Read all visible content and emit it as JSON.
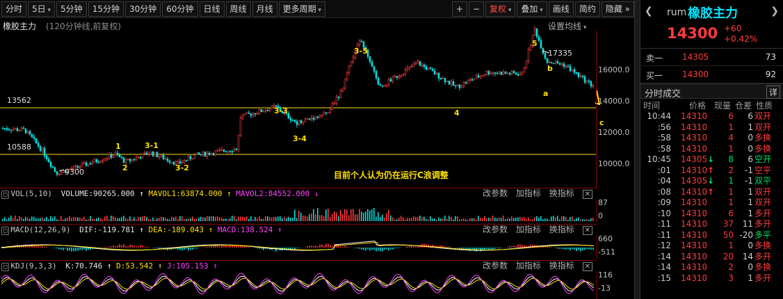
{
  "toolbar": {
    "items": [
      "分时",
      "5日",
      "5分钟",
      "15分钟",
      "30分钟",
      "60分钟",
      "日线",
      "周线",
      "月线",
      "更多周期"
    ],
    "right_items": [
      "+",
      "−",
      "复权",
      "叠加",
      "画线",
      "简约",
      "隐藏"
    ],
    "more_icon": "double-chevron-right-icon"
  },
  "main_chart": {
    "title": "橡胶主力",
    "subtitle": "(120分钟线,前复权)",
    "ma_setting": "设置均线",
    "y_ticks": [
      "16000.0",
      "14000.0",
      "12000.0",
      "10000.0"
    ],
    "ref_lines": [
      "13562",
      "10588"
    ],
    "high_label": "17335",
    "low_label": "9300",
    "waves": [
      "1",
      "2",
      "3-1",
      "3-2",
      "3-3",
      "3-4",
      "3-5",
      "4",
      "5",
      "a",
      "b",
      "c"
    ],
    "annotation": "目前个人认为仍在运行C浪调整"
  },
  "vol_panel": {
    "name": "VOL(5,10)",
    "volume": "VOLUME:90265.000",
    "mavol1": "MAVOL1:63874.000",
    "mavol2": "MAVOL2:84552.000",
    "y_ticks": [
      "87",
      "0"
    ]
  },
  "macd_panel": {
    "name": "MACD(12,26,9)",
    "dif": "DIF:-119.781",
    "dea": "DEA:-189.043",
    "macd": "MACD:138.524",
    "y_ticks": [
      "660",
      "-511"
    ]
  },
  "kdj_panel": {
    "name": "KDJ(9,3,3)",
    "k": "K:70.746",
    "d": "D:53.542",
    "j": "J:105.153",
    "y_ticks": [
      "116",
      "-13"
    ]
  },
  "panel_tools": {
    "params": "改参数",
    "add": "加指标",
    "swap": "换指标"
  },
  "quote": {
    "code": "rum",
    "name": "橡胶主力",
    "price": "14300",
    "change": "+60",
    "change_pct": "+0.42%",
    "sell1_label": "卖一",
    "sell1_price": "14305",
    "sell1_vol": "73",
    "buy1_label": "买一",
    "buy1_price": "14300",
    "buy1_vol": "92"
  },
  "ticks": {
    "title": "分时成交",
    "detail": "详",
    "headers": [
      "时间",
      "价格",
      "现量",
      "仓差",
      "性质"
    ],
    "rows": [
      {
        "time": "10:44",
        "price": "14310",
        "arrow": "",
        "vol": "6",
        "oi": "6",
        "nature": "双开"
      },
      {
        "time": ":56",
        "price": "14310",
        "arrow": "",
        "vol": "1",
        "oi": "1",
        "nature": "双开"
      },
      {
        "time": ":58",
        "price": "14310",
        "arrow": "",
        "vol": "4",
        "oi": "0",
        "nature": "多换"
      },
      {
        "time": ":58",
        "price": "14310",
        "arrow": "",
        "vol": "1",
        "oi": "0",
        "nature": "多换"
      },
      {
        "time": "10:45",
        "price": "14305",
        "arrow": "down",
        "vol": "8",
        "oi": "6",
        "nature": "空开"
      },
      {
        "time": ":01",
        "price": "14310",
        "arrow": "up",
        "vol": "2",
        "oi": "-1",
        "nature": "空平"
      },
      {
        "time": ":04",
        "price": "14305",
        "arrow": "down",
        "vol": "1",
        "oi": "-1",
        "nature": "双平"
      },
      {
        "time": ":08",
        "price": "14310",
        "arrow": "up",
        "vol": "1",
        "oi": "1",
        "nature": "双开"
      },
      {
        "time": ":09",
        "price": "14310",
        "arrow": "",
        "vol": "1",
        "oi": "1",
        "nature": "双开"
      },
      {
        "time": ":10",
        "price": "14310",
        "arrow": "",
        "vol": "6",
        "oi": "1",
        "nature": "多开"
      },
      {
        "time": ":11",
        "price": "14310",
        "arrow": "",
        "vol": "37",
        "oi": "11",
        "nature": "多开"
      },
      {
        "time": ":11",
        "price": "14310",
        "arrow": "",
        "vol": "50",
        "oi": "-20",
        "nature": "多平"
      },
      {
        "time": ":12",
        "price": "14310",
        "arrow": "",
        "vol": "1",
        "oi": "0",
        "nature": "多换"
      },
      {
        "time": ":14",
        "price": "14310",
        "arrow": "",
        "vol": "20",
        "oi": "14",
        "nature": "多开"
      },
      {
        "time": ":14",
        "price": "14310",
        "arrow": "",
        "vol": "2",
        "oi": "0",
        "nature": "多换"
      },
      {
        "time": ":15",
        "price": "14310",
        "arrow": "",
        "vol": "3",
        "oi": "1",
        "nature": "多开"
      }
    ]
  },
  "colors": {
    "up": "#ff3b3b",
    "down": "#00e0e0",
    "ref_line": "#ffe000",
    "accent_name": "#00e5ff"
  }
}
